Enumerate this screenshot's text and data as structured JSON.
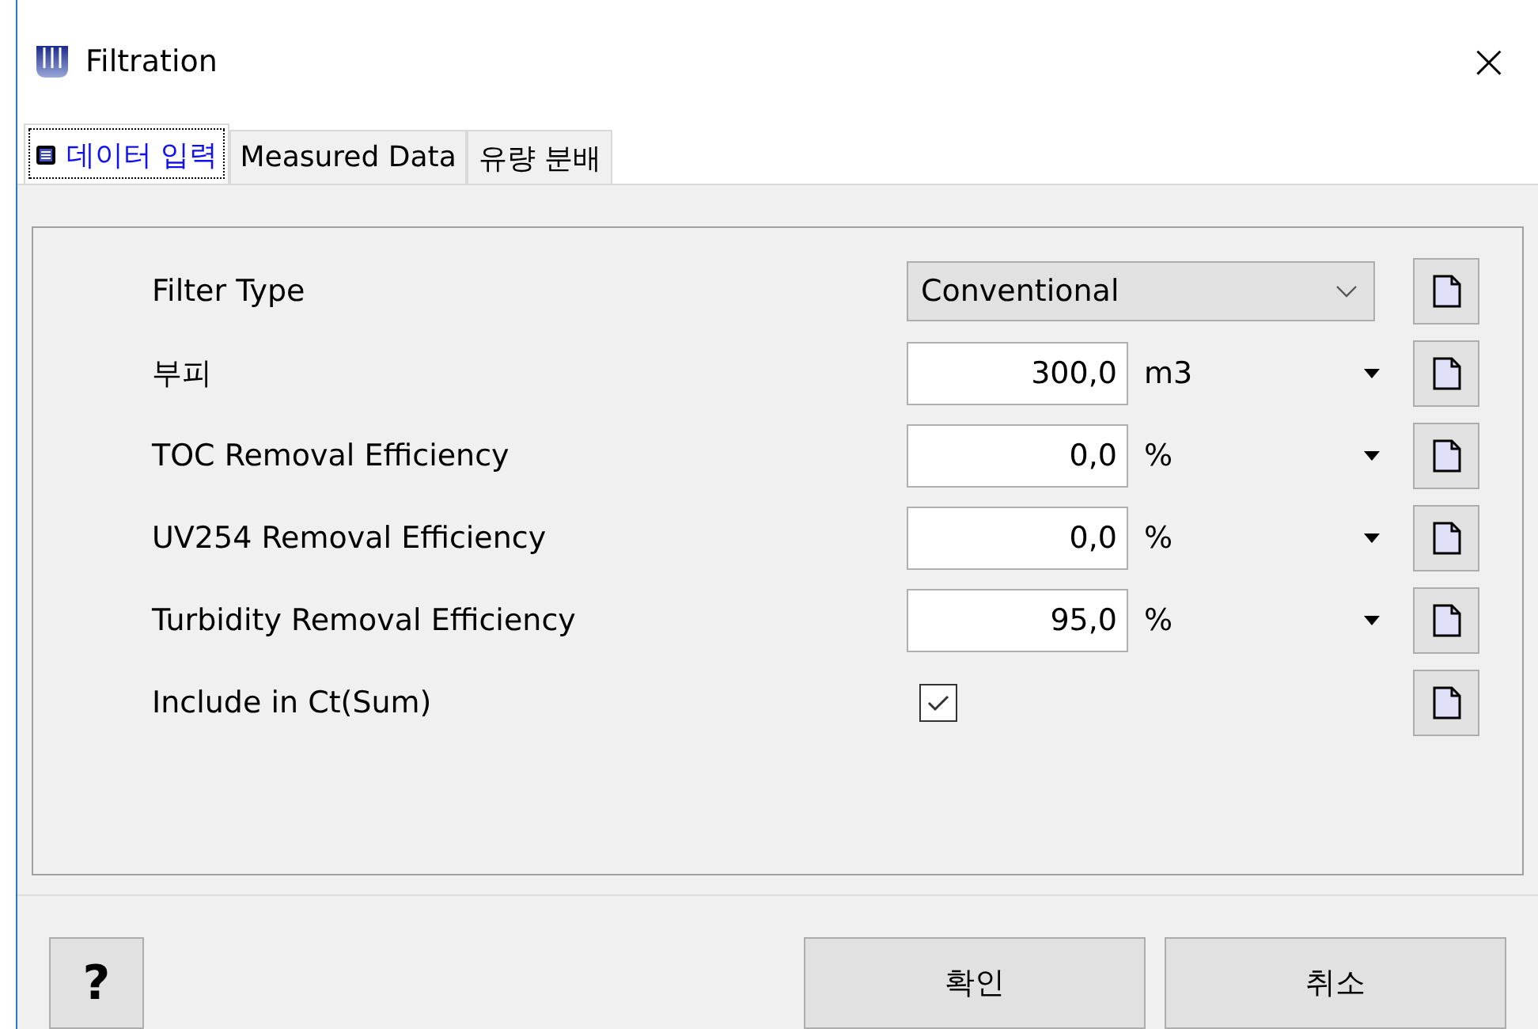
{
  "window": {
    "title": "Filtration",
    "close": "×"
  },
  "tabs": [
    {
      "label": "데이터 입력",
      "selected": true
    },
    {
      "label": "Measured Data",
      "selected": false
    },
    {
      "label": "유량 분배",
      "selected": false
    }
  ],
  "fields": [
    {
      "kind": "dropdown",
      "label": "Filter Type",
      "value": "Conventional"
    },
    {
      "kind": "number",
      "label": "부피",
      "value": "300,0",
      "unit": "m3"
    },
    {
      "kind": "number",
      "label": "TOC Removal Efficiency",
      "value": "0,0",
      "unit": "%"
    },
    {
      "kind": "number",
      "label": "UV254 Removal Efficiency",
      "value": "0,0",
      "unit": "%"
    },
    {
      "kind": "number",
      "label": "Turbidity Removal Efficiency",
      "value": "95,0",
      "unit": "%"
    },
    {
      "kind": "checkbox",
      "label": "Include in Ct(Sum)",
      "checked": true
    }
  ],
  "help_button": "?",
  "buttons": [
    "확인",
    "취소"
  ]
}
